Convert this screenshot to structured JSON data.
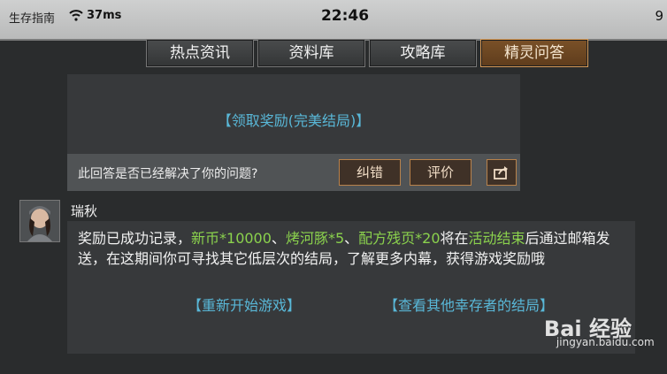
{
  "statusbar": {
    "carrier": "生存指南",
    "ping": "37ms",
    "time": "22:46",
    "right": "9"
  },
  "tabs": [
    {
      "label": "热点资讯",
      "active": false
    },
    {
      "label": "资料库",
      "active": false
    },
    {
      "label": "攻略库",
      "active": false
    },
    {
      "label": "精灵问答",
      "active": true
    }
  ],
  "top_panel": {
    "claim_link": "【领取奖励(完美结局)】",
    "question": "此回答是否已经解决了你的问题?",
    "correct_button": "纠错",
    "rate_button": "评价"
  },
  "answer": {
    "name": "瑞秋",
    "text_parts": [
      {
        "text": "奖励已成功记录，",
        "highlight": false
      },
      {
        "text": "新币*10000",
        "highlight": true
      },
      {
        "text": "、",
        "highlight": false
      },
      {
        "text": "烤河豚*5",
        "highlight": true
      },
      {
        "text": "、",
        "highlight": false
      },
      {
        "text": "配方残页*20",
        "highlight": true
      },
      {
        "text": "将在",
        "highlight": false
      },
      {
        "text": "活动结束",
        "highlight": true
      },
      {
        "text": "后通过邮箱发送，在这期间你可寻找其它低层次的结局，了解更多内幕，获得游戏奖励哦",
        "highlight": false
      }
    ],
    "restart_link": "【重新开始游戏】",
    "others_link": "【查看其他幸存者的结局】"
  },
  "watermark": {
    "logo": "Bai 经验",
    "url": "jingyan.baidu.com"
  },
  "colors": {
    "link": "#59b8d8",
    "highlight": "#8bd24d",
    "active_tab": "#6b4522"
  }
}
